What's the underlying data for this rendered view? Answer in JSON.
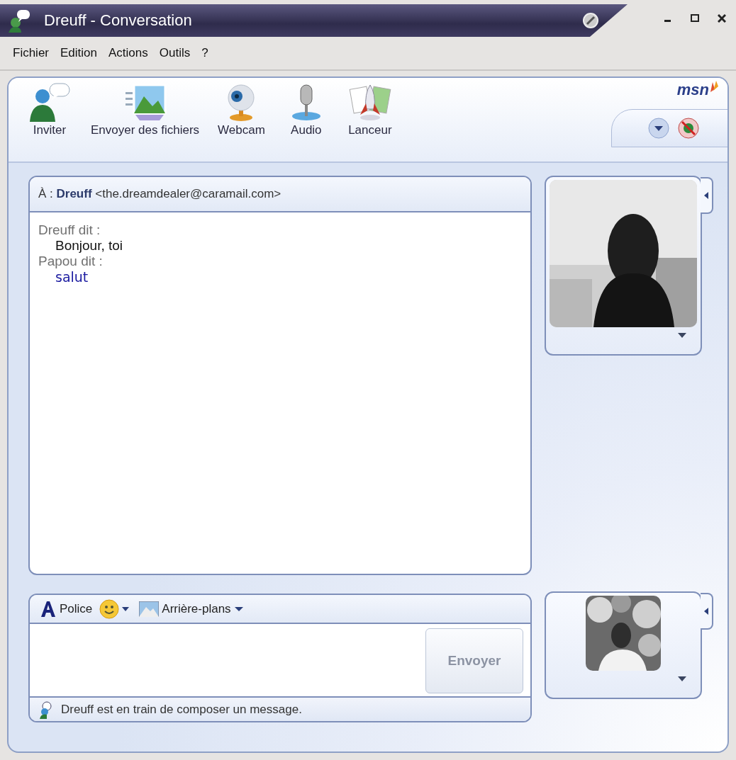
{
  "window": {
    "title": "Dreuff - Conversation"
  },
  "logo": "msn",
  "menu": [
    "Fichier",
    "Edition",
    "Actions",
    "Outils",
    "?"
  ],
  "toolbar": [
    {
      "kind": "invite",
      "label": "Inviter"
    },
    {
      "kind": "files",
      "label": "Envoyer des fichiers"
    },
    {
      "kind": "webcam",
      "label": "Webcam"
    },
    {
      "kind": "audio",
      "label": "Audio"
    },
    {
      "kind": "launcher",
      "label": "Lanceur"
    }
  ],
  "to": {
    "label": "À :",
    "name": "Dreuff",
    "address": "<the.dreamdealer@caramail.com>"
  },
  "messages": [
    {
      "kind": "contact",
      "header": "Dreuff dit :",
      "text": "Bonjour, toi"
    },
    {
      "kind": "self",
      "header": "Papou dit :",
      "text": "salut"
    }
  ],
  "format_bar": {
    "font": "Police",
    "backgrounds": "Arrière-plans"
  },
  "send_button": {
    "label": "Envoyer",
    "disabled": true
  },
  "status": "Dreuff est en train de composer un message."
}
